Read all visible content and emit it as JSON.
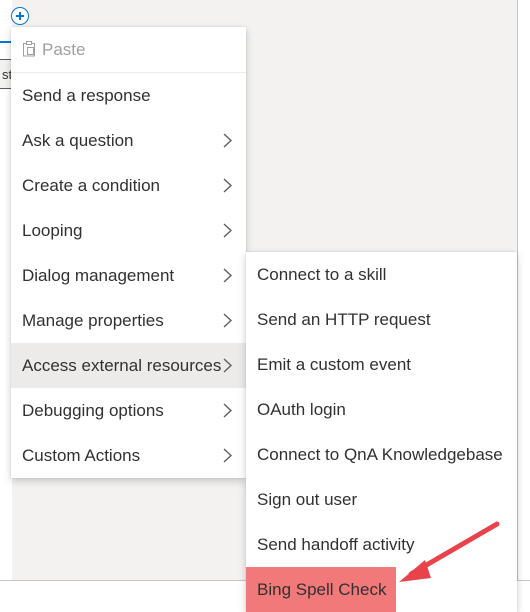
{
  "menu": {
    "paste_label": "Paste",
    "items": [
      {
        "label": "Send a response",
        "has_submenu": false
      },
      {
        "label": "Ask a question",
        "has_submenu": true
      },
      {
        "label": "Create a condition",
        "has_submenu": true
      },
      {
        "label": "Looping",
        "has_submenu": true
      },
      {
        "label": "Dialog management",
        "has_submenu": true
      },
      {
        "label": "Manage properties",
        "has_submenu": true
      },
      {
        "label": "Access external resources",
        "has_submenu": true
      },
      {
        "label": "Debugging options",
        "has_submenu": true
      },
      {
        "label": "Custom Actions",
        "has_submenu": true
      }
    ]
  },
  "submenu": {
    "items": [
      {
        "label": "Connect to a skill"
      },
      {
        "label": "Send an HTTP request"
      },
      {
        "label": "Emit a custom event"
      },
      {
        "label": "OAuth login"
      },
      {
        "label": "Connect to QnA Knowledgebase"
      },
      {
        "label": "Sign out user"
      },
      {
        "label": "Send handoff activity"
      },
      {
        "label": "Bing Spell Check"
      }
    ]
  },
  "canvas": {
    "node_stub_text": "st"
  },
  "colors": {
    "accent": "#0078d4",
    "highlight": "#f1797a",
    "arrow": "#e8434a"
  }
}
